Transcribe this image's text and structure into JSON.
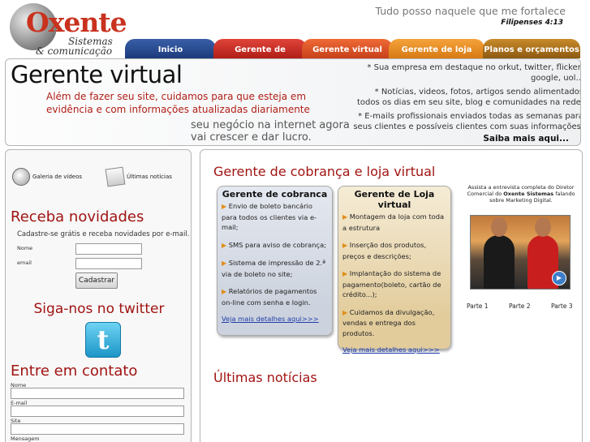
{
  "header": {
    "logo": {
      "main": "Oxente",
      "line1": "Sistemas",
      "line2": "& comunicação"
    },
    "motto": "Tudo posso naquele que me fortalece",
    "verse": "Filipenses 4:13"
  },
  "nav": {
    "tabs": [
      {
        "label": "Inicio",
        "color": "#1c3b7c"
      },
      {
        "label": "Gerente de cobrança",
        "color": "#b01e16"
      },
      {
        "label": "Gerente virtual",
        "color": "#c7401a"
      },
      {
        "label": "Gerente de loja virtual",
        "color": "#d77a14"
      },
      {
        "label": "Planos e orçamentos",
        "color": "#8d5a12"
      }
    ]
  },
  "banner": {
    "title": "Gerente virtual",
    "description": "Além de fazer seu site, cuidamos para que esteja em evidência e com informações atualizadas diariamente",
    "tagline": "seu negócio na internet agora vai crescer e dar lucro.",
    "bullets": [
      "* Sua empresa em destaque no orkut, twitter, flicker, google, uol...",
      "* Notícias, videos, fotos, artigos sendo alimentados todos os dias em seu site, blog e comunidades na rede.",
      "* E-mails profissionais enviados todas as semanas para seus clientes e possíveis clientes com suas informações."
    ],
    "cta": "Saiba mais aqui..."
  },
  "sidebar": {
    "quicklinks": [
      {
        "label": "Galeria de vídeos",
        "icon": "video-gallery-icon"
      },
      {
        "label": "Últimas notícias",
        "icon": "newspaper-icon"
      }
    ],
    "newsletter": {
      "title": "Receba novidades",
      "text": "Cadastre-se grátis e receba novidades por e-mail.",
      "name_label": "Nome",
      "email_label": "email",
      "button": "Cadastrar"
    },
    "twitter": {
      "title": "Siga-nos no twitter",
      "icon": "twitter-bird-icon",
      "glyph": "t"
    },
    "contact": {
      "title": "Entre em contato",
      "name_label": "Nome",
      "email_label": "E-mail",
      "site_label": "Site",
      "message_label": "Mensagem"
    }
  },
  "main": {
    "title": "Gerente de cobrança e loja virtual",
    "cards": [
      {
        "title": "Gerente de cobranca",
        "items": [
          "Envio de boleto bancário para todos os clientes via e-mail;",
          "SMS para aviso de cobrança;",
          "Sistema de impressão de 2.ª via de boleto no site;",
          "Relatórios de pagamentos on-line com senha e login."
        ],
        "link": "Veja mais detalhes aqui>>>"
      },
      {
        "title": "Gerente  de Loja virtual",
        "items": [
          "Montagem da loja com toda a estrutura",
          "Inserção dos produtos, preços e descrições;",
          "Implantação do sistema de pagamento(boleto, cartão de crédito...);",
          "Cuidamos da divulgação, vendas e entrega dos produtos."
        ],
        "link": "Veja mais detalhes aqui>>>"
      }
    ],
    "video": {
      "caption_prefix": "Assista a entrevista completa do Diretor Comercial do ",
      "caption_bold": "Oxente Sistemas",
      "caption_suffix": " falando sobre Marketing Digital.",
      "parts": [
        "Parte 1",
        "Parte 2",
        "Parte 3"
      ]
    },
    "news_title": "Últimas notícias"
  }
}
